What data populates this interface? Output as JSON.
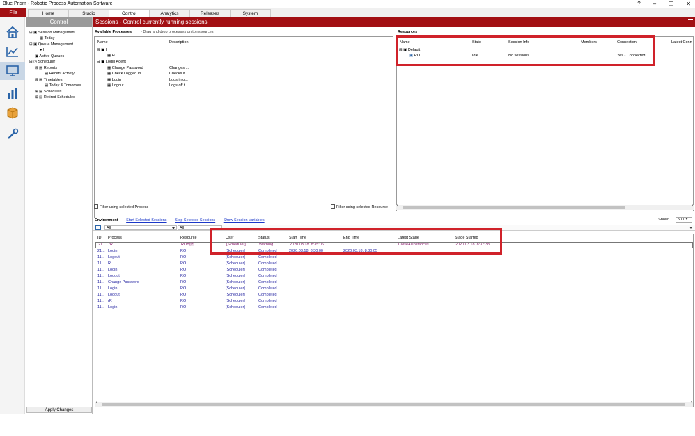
{
  "window": {
    "title": "Blue Prism - Robotic Process Automation Software",
    "help": "?",
    "minimize": "–",
    "restore": "❐",
    "close": "✕"
  },
  "menu": {
    "file": "File",
    "tabs": [
      "Home",
      "Studio",
      "Control",
      "Analytics",
      "Releases",
      "System"
    ],
    "active_tab": "Control"
  },
  "leftbar": {
    "icons": [
      "home-icon",
      "chart-line-icon",
      "monitor-icon",
      "bar-chart-icon",
      "package-icon",
      "tools-icon"
    ]
  },
  "nav": {
    "title": "Control",
    "items": [
      "Session Management",
      "Today",
      "Queue Management",
      "I",
      "Active Queues",
      "Scheduler",
      "Reports",
      "Recent Activity",
      "Timetables",
      "Today & Tomorrow",
      "Schedules",
      "Retired Schedules"
    ],
    "apply": "Apply Changes"
  },
  "main": {
    "banner": "Sessions - Control currently running sessions"
  },
  "processes": {
    "title": "Available Processes",
    "hint": "- Drag and drop processes on to resources",
    "columns": [
      "Name",
      "Description"
    ],
    "rows": [
      {
        "name": "I",
        "desc": ""
      },
      {
        "name": "H",
        "desc": ""
      },
      {
        "name": "Login Agent",
        "desc": ""
      },
      {
        "name": "Change Password",
        "desc": "Changes ..."
      },
      {
        "name": "Check Logged In",
        "desc": "Checks if ..."
      },
      {
        "name": "Login",
        "desc": "Logs into..."
      },
      {
        "name": "Logout",
        "desc": "Logs off t..."
      }
    ],
    "filter": "Filter using selected Process"
  },
  "resources": {
    "title": "Resources",
    "columns": [
      "Name",
      "State",
      "Session Info",
      "Members",
      "Connection",
      "Latest Conn"
    ],
    "group": "Default",
    "row": {
      "name": "RO",
      "state": "Idle",
      "info": "No sessions",
      "connection": "Yes - Connected"
    },
    "filter": "Filter using selected Resource"
  },
  "environment": {
    "label": "Environment",
    "links": [
      "Start Selected Sessions",
      "Stop Selected Sessions",
      "Show Session Variables"
    ],
    "show_label": "Show:",
    "show_value": "500",
    "filter_all": "All",
    "columns": [
      "ID",
      "Process",
      "Resource",
      "User",
      "Status",
      "Start Time",
      "End Time",
      "Latest Stage",
      "Stage Started"
    ],
    "rows": [
      {
        "id": "21...",
        "process": "rR",
        "resource": "ROB\u0001",
        "user": "[Scheduler]",
        "status": "Warning",
        "start": "2020.03.18. 8:35:06",
        "end": "",
        "stage": "CloseAllInstances",
        "stage_started": "2020.03.18. 8:37:38"
      },
      {
        "id": "21...",
        "process": "Login",
        "resource": "RO",
        "user": "[Scheduler]",
        "status": "Completed",
        "start": "2020.03.18. 8:30:00",
        "end": "2020.03.18. 8:30:05",
        "stage": "",
        "stage_started": ""
      },
      {
        "id": "11...",
        "process": "Logout",
        "resource": "RO",
        "user": "[Scheduler]",
        "status": "Completed",
        "start": "",
        "end": "",
        "stage": "",
        "stage_started": ""
      },
      {
        "id": "11...",
        "process": "R",
        "resource": "RO",
        "user": "[Scheduler]",
        "status": "Completed",
        "start": "",
        "end": "",
        "stage": "",
        "stage_started": ""
      },
      {
        "id": "11...",
        "process": "Login",
        "resource": "RO",
        "user": "[Scheduler]",
        "status": "Completed",
        "start": "",
        "end": "",
        "stage": "",
        "stage_started": ""
      },
      {
        "id": "11...",
        "process": "Logout",
        "resource": "RO",
        "user": "[Scheduler]",
        "status": "Completed",
        "start": "",
        "end": "",
        "stage": "",
        "stage_started": ""
      },
      {
        "id": "11...",
        "process": "Change Password",
        "resource": "RO",
        "user": "[Scheduler]",
        "status": "Completed",
        "start": "",
        "end": "",
        "stage": "",
        "stage_started": ""
      },
      {
        "id": "11...",
        "process": "Login",
        "resource": "RO",
        "user": "[Scheduler]",
        "status": "Completed",
        "start": "",
        "end": "",
        "stage": "",
        "stage_started": ""
      },
      {
        "id": "11...",
        "process": "Logout",
        "resource": "RO",
        "user": "[Scheduler]",
        "status": "Completed",
        "start": "",
        "end": "",
        "stage": "",
        "stage_started": ""
      },
      {
        "id": "11...",
        "process": "rR",
        "resource": "RO",
        "user": "[Scheduler]",
        "status": "Completed",
        "start": "",
        "end": "",
        "stage": "",
        "stage_started": ""
      },
      {
        "id": "11...",
        "process": "Login",
        "resource": "RO",
        "user": "[Scheduler]",
        "status": "Completed",
        "start": "",
        "end": "",
        "stage": "",
        "stage_started": ""
      }
    ]
  },
  "colors": {
    "brand_red": "#a20f13",
    "highlight_red": "#d0222a",
    "link_blue": "#1a37c8",
    "row_text": "#1d1d9e",
    "warning_text": "#8a1e6e"
  }
}
